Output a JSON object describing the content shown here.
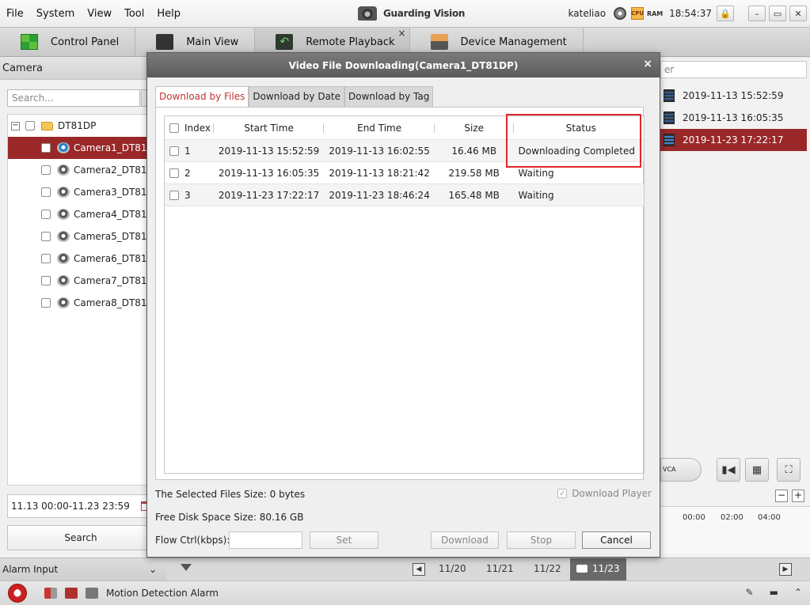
{
  "menu": [
    "File",
    "System",
    "View",
    "Tool",
    "Help"
  ],
  "app_title": "Guarding Vision",
  "user": "kateliao",
  "cpu_badge": "CPU",
  "ram_badge": "RAM",
  "clock": "18:54:37",
  "window_buttons": {
    "lock": "🔒",
    "minimize": "–",
    "restore": "▭",
    "close": "✕"
  },
  "tabs": [
    {
      "label": "Control Panel",
      "icon": "control-panel-icon"
    },
    {
      "label": "Main View",
      "icon": "main-view-icon"
    },
    {
      "label": "Remote Playback",
      "icon": "remote-playback-icon",
      "active": true
    },
    {
      "label": "Device Management",
      "icon": "device-management-icon"
    }
  ],
  "left": {
    "header": "Camera",
    "search_placeholder": "Search...",
    "root": "DT81DP",
    "cameras": [
      "Camera1_DT81...",
      "Camera2_DT81...",
      "Camera3_DT81...",
      "Camera4_DT81...",
      "Camera5_DT81...",
      "Camera6_DT81...",
      "Camera7_DT81...",
      "Camera8_DT81..."
    ],
    "date_range": "11.13 00:00-11.23 23:59",
    "search_button": "Search"
  },
  "right": {
    "filter_placeholder_fragment": "er",
    "files": [
      "2019-11-13 15:52:59",
      "2019-11-13 16:05:35",
      "2019-11-23 17:22:17"
    ],
    "vca_label": "VCA",
    "ticks": [
      "00:00",
      "02:00",
      "04:00"
    ],
    "zoom_out": "−",
    "zoom_in": "+"
  },
  "bottom": {
    "alarm_input_label": "Alarm Input",
    "dates": [
      "11/20",
      "11/21",
      "11/22",
      "11/23"
    ],
    "motion_alarm": "Motion Detection Alarm"
  },
  "dialog": {
    "title": "Video File Downloading(Camera1_DT81DP)",
    "close_label": "×",
    "tabs": [
      "Download by Files",
      "Download by Date",
      "Download by Tag"
    ],
    "columns": {
      "index": "Index",
      "start": "Start Time",
      "end": "End Time",
      "size": "Size",
      "status": "Status"
    },
    "rows": [
      {
        "index": "1",
        "start": "2019-11-13 15:52:59",
        "end": "2019-11-13 16:02:55",
        "size": "16.46 MB",
        "status": "Downloading Completed"
      },
      {
        "index": "2",
        "start": "2019-11-13 16:05:35",
        "end": "2019-11-13 18:21:42",
        "size": "219.58 MB",
        "status": "Waiting"
      },
      {
        "index": "3",
        "start": "2019-11-23 17:22:17",
        "end": "2019-11-23 18:46:24",
        "size": "165.48 MB",
        "status": "Waiting"
      }
    ],
    "selected_size_label": "The Selected Files Size:",
    "selected_size_value": "0 bytes",
    "free_disk_label": "Free Disk Space Size:",
    "free_disk_value": "80.16 GB",
    "flow_ctrl_label": "Flow Ctrl(kbps):",
    "download_player_label": "Download Player",
    "buttons": {
      "set": "Set",
      "download": "Download",
      "stop": "Stop",
      "cancel": "Cancel"
    }
  }
}
